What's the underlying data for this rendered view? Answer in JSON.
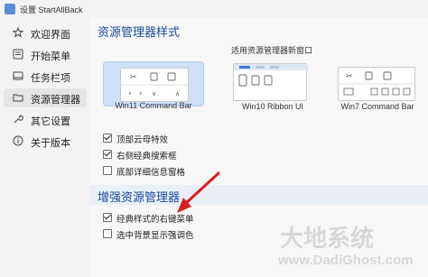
{
  "window": {
    "title": "设置 StartAllBack"
  },
  "sidebar": {
    "items": [
      {
        "label": "欢迎界面",
        "icon": "welcome-icon",
        "active": false
      },
      {
        "label": "开始菜单",
        "icon": "start-menu-icon",
        "active": false
      },
      {
        "label": "任务栏项",
        "icon": "taskbar-icon",
        "active": false
      },
      {
        "label": "资源管理器",
        "icon": "folder-icon",
        "active": true
      },
      {
        "label": "其它设置",
        "icon": "wrench-icon",
        "active": false
      },
      {
        "label": "关于版本",
        "icon": "info-icon",
        "active": false
      }
    ]
  },
  "explorer_style": {
    "title": "资源管理器样式",
    "apply_hint": "适用资源管理器新窗口",
    "options": [
      {
        "label": "Win11 Command Bar",
        "selected": true
      },
      {
        "label": "Win10 Ribbon UI",
        "selected": false
      },
      {
        "label": "Win7 Command Bar",
        "selected": false
      }
    ]
  },
  "style_checks": [
    {
      "label": "顶部云母特效",
      "checked": true
    },
    {
      "label": "右侧经典搜索框",
      "checked": true
    },
    {
      "label": "底部详细信息窗格",
      "checked": false
    }
  ],
  "enhance": {
    "title": "增强资源管理器",
    "checks": [
      {
        "label": "经典样式的右键菜单",
        "checked": true
      },
      {
        "label": "选中背景显示强调色",
        "checked": false
      }
    ]
  },
  "watermark": {
    "line1": "大地系统",
    "line2": "www.DadiGhost.com"
  },
  "colors": {
    "accent": "#1a4b9c",
    "selected_card": "#cfe1f8",
    "arrow": "#d81e1e"
  }
}
